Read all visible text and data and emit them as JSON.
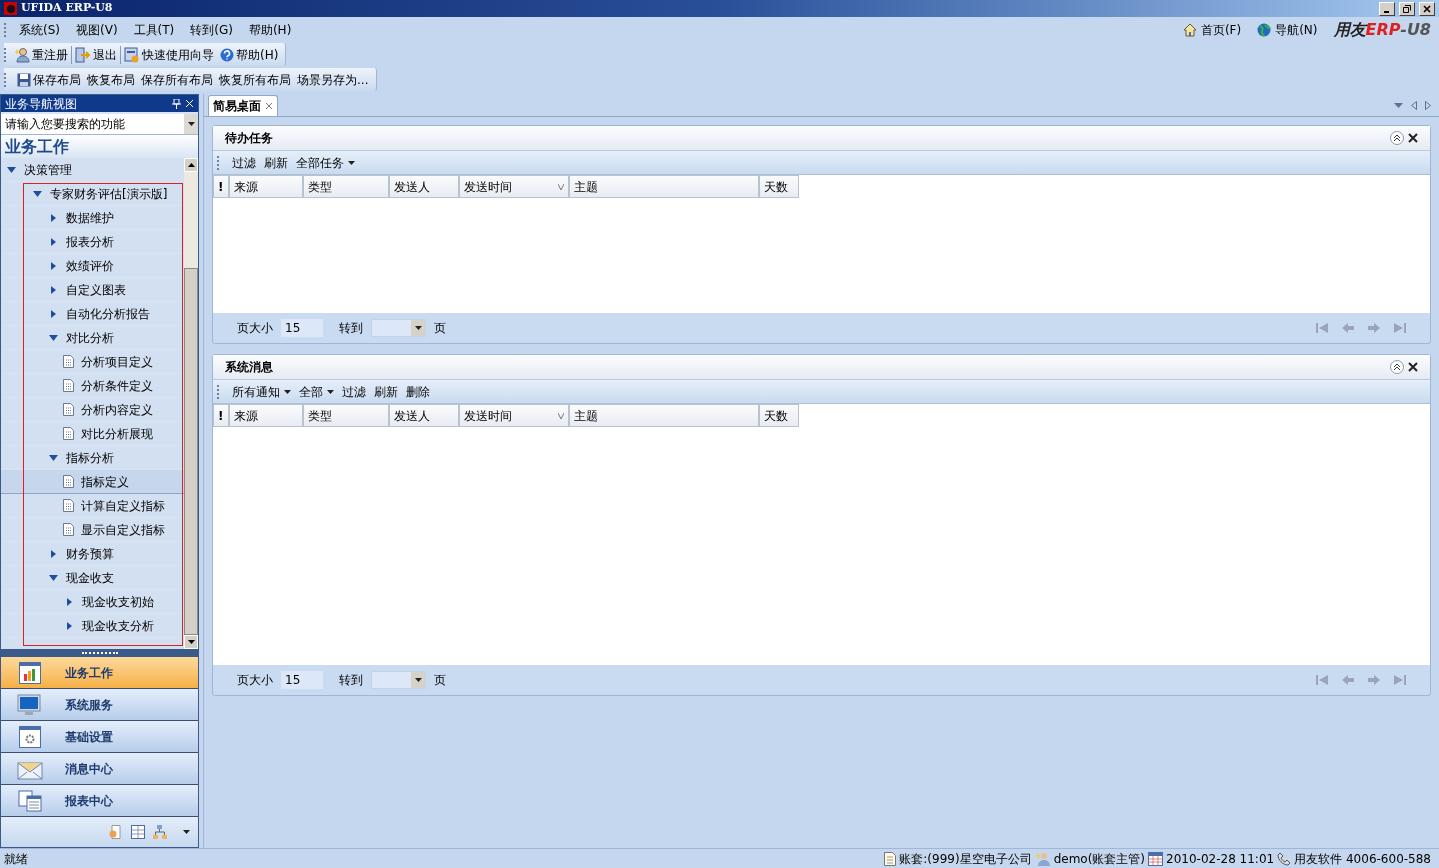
{
  "window": {
    "title": "UFIDA ERP-U8"
  },
  "menu": [
    "系统(S)",
    "视图(V)",
    "工具(T)",
    "转到(G)",
    "帮助(H)"
  ],
  "top_links": [
    {
      "label": "首页(F)",
      "kind": "home"
    },
    {
      "label": "导航(N)",
      "kind": "globe"
    }
  ],
  "logo": {
    "brand": "用友",
    "product": "ERP",
    "suffix": "-U8"
  },
  "toolbar_1": [
    {
      "label": "重注册",
      "kind": "user"
    },
    {
      "label": "退出",
      "kind": "exit"
    },
    {
      "label": "快速使用向导",
      "kind": "wizard"
    },
    {
      "label": "帮助(H)",
      "kind": "help"
    }
  ],
  "toolbar_2": [
    {
      "label": "保存布局",
      "kind": "save"
    },
    {
      "label": "恢复布局",
      "kind": "text"
    },
    {
      "label": "保存所有布局",
      "kind": "text"
    },
    {
      "label": "恢复所有布局",
      "kind": "text"
    },
    {
      "label": "场景另存为...",
      "kind": "text"
    }
  ],
  "nav_panel": {
    "title": "业务导航视图",
    "search": {
      "placeholder": "请输入您要搜索的功能"
    },
    "heading": "业务工作",
    "tree": [
      {
        "label": "决策管理",
        "kind": "folder",
        "expanded": true,
        "selected": false,
        "children": [
          {
            "label": "专家财务评估[演示版]",
            "kind": "folder",
            "expanded": true,
            "selected": false,
            "children": [
              {
                "label": "数据维护",
                "kind": "folder",
                "expanded": false,
                "selected": false
              },
              {
                "label": "报表分析",
                "kind": "folder",
                "expanded": false,
                "selected": false
              },
              {
                "label": "效绩评价",
                "kind": "folder",
                "expanded": false,
                "selected": false
              },
              {
                "label": "自定义图表",
                "kind": "folder",
                "expanded": false,
                "selected": false
              },
              {
                "label": "自动化分析报告",
                "kind": "folder",
                "expanded": false,
                "selected": false
              },
              {
                "label": "对比分析",
                "kind": "folder",
                "expanded": true,
                "selected": false,
                "children": [
                  {
                    "label": "分析项目定义",
                    "kind": "item",
                    "selected": false
                  },
                  {
                    "label": "分析条件定义",
                    "kind": "item",
                    "selected": false
                  },
                  {
                    "label": "分析内容定义",
                    "kind": "item",
                    "selected": false
                  },
                  {
                    "label": "对比分析展现",
                    "kind": "item",
                    "selected": false
                  }
                ]
              },
              {
                "label": "指标分析",
                "kind": "folder",
                "expanded": true,
                "selected": false,
                "children": [
                  {
                    "label": "指标定义",
                    "kind": "item",
                    "selected": true
                  },
                  {
                    "label": "计算自定义指标",
                    "kind": "item",
                    "selected": false
                  },
                  {
                    "label": "显示自定义指标",
                    "kind": "item",
                    "selected": false
                  }
                ]
              },
              {
                "label": "财务预算",
                "kind": "folder",
                "expanded": false,
                "selected": false
              },
              {
                "label": "现金收支",
                "kind": "folder",
                "expanded": true,
                "selected": false,
                "children": [
                  {
                    "label": "现金收支初始",
                    "kind": "folder",
                    "expanded": false,
                    "selected": false
                  },
                  {
                    "label": "现金收支分析",
                    "kind": "folder",
                    "expanded": false,
                    "selected": false
                  }
                ]
              }
            ]
          }
        ]
      }
    ],
    "sections": [
      {
        "label": "业务工作",
        "kind": "chart",
        "selected": true
      },
      {
        "label": "系统服务",
        "kind": "monitor",
        "selected": false
      },
      {
        "label": "基础设置",
        "kind": "gear",
        "selected": false
      },
      {
        "label": "消息中心",
        "kind": "mail",
        "selected": false
      },
      {
        "label": "报表中心",
        "kind": "report",
        "selected": false
      }
    ]
  },
  "tabs": [
    {
      "label": "简易桌面",
      "selected": true
    }
  ],
  "panels": [
    {
      "title": "待办任务",
      "actions": [
        {
          "label": "过滤",
          "dropdown": false
        },
        {
          "label": "刷新",
          "dropdown": false
        },
        {
          "label": "全部任务",
          "dropdown": true
        }
      ],
      "columns": [
        {
          "label": "!",
          "kind": "flag"
        },
        {
          "label": "来源",
          "kind": "wide"
        },
        {
          "label": "类型",
          "kind": "wider"
        },
        {
          "label": "发送人",
          "kind": "mid"
        },
        {
          "label": "发送时间",
          "kind": "sort"
        },
        {
          "label": "主题",
          "kind": "subject"
        },
        {
          "label": "天数",
          "kind": "narrow"
        }
      ],
      "pager": {
        "size_label": "页大小",
        "size": "15",
        "goto_label": "转到",
        "page_label": "页"
      }
    },
    {
      "title": "系统消息",
      "actions": [
        {
          "label": "所有通知",
          "dropdown": true
        },
        {
          "label": "全部",
          "dropdown": true
        },
        {
          "label": "过滤",
          "dropdown": false
        },
        {
          "label": "刷新",
          "dropdown": false
        },
        {
          "label": "删除",
          "dropdown": false
        }
      ],
      "columns": [
        {
          "label": "!",
          "kind": "flag"
        },
        {
          "label": "来源",
          "kind": "wide"
        },
        {
          "label": "类型",
          "kind": "wider"
        },
        {
          "label": "发送人",
          "kind": "mid"
        },
        {
          "label": "发送时间",
          "kind": "sort"
        },
        {
          "label": "主题",
          "kind": "subject"
        },
        {
          "label": "天数",
          "kind": "narrow"
        }
      ],
      "pager": {
        "size_label": "页大小",
        "size": "15",
        "goto_label": "转到",
        "page_label": "页"
      }
    }
  ],
  "status_bar": {
    "state": "就绪",
    "items": [
      {
        "label": "账套:(999)星空电子公司",
        "kind": "doc"
      },
      {
        "label": "demo(账套主管)",
        "kind": "user"
      },
      {
        "label": "2010-02-28 11:01",
        "kind": "calendar"
      },
      {
        "label": "用友软件 4006-600-588",
        "kind": "phone"
      }
    ]
  }
}
